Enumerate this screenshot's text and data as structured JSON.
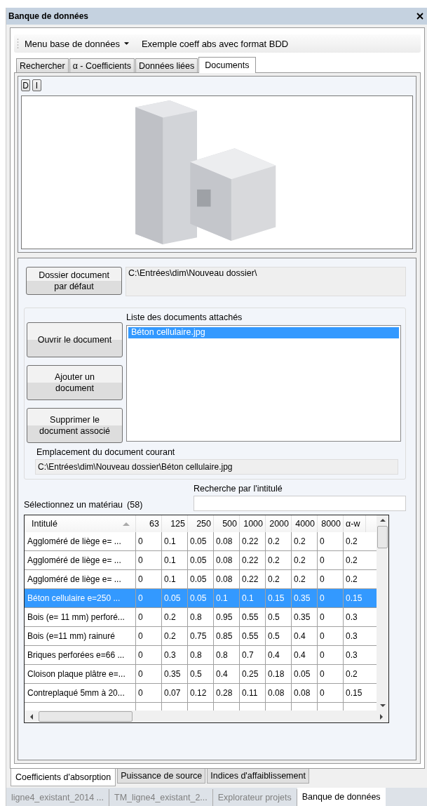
{
  "window": {
    "title": "Banque de données"
  },
  "toolbar": {
    "menu": "Menu base de données",
    "label": "Exemple coeff abs avec format BDD"
  },
  "tabs": [
    {
      "label": "Rechercher",
      "selected": false
    },
    {
      "label": "α - Coefficients",
      "selected": false
    },
    {
      "label": "Données liées",
      "selected": false
    },
    {
      "label": "Documents",
      "selected": true
    }
  ],
  "image_buttons": [
    "D",
    "I"
  ],
  "default_folder": {
    "button": "Dossier document par défaut",
    "path": "C:\\Entrées\\dim\\Nouveau dossier\\"
  },
  "documents": {
    "label": "Liste des documents attachés",
    "items": [
      {
        "name": "Béton cellulaire.jpg",
        "selected": true
      }
    ],
    "buttons": [
      "Ouvrir le document",
      "Ajouter un document",
      "Supprimer le document associé"
    ],
    "location_label": "Emplacement du document courant",
    "location": "C:\\Entrées\\dim\\Nouveau dossier\\Béton cellulaire.jpg"
  },
  "search": {
    "label": "Recherche par l'intitulé",
    "select_label": "Sélectionnez un matériau",
    "count": "(58)"
  },
  "table": {
    "columns": [
      "Intitulé",
      "63",
      "125",
      "250",
      "500",
      "1000",
      "2000",
      "4000",
      "8000",
      "α-w"
    ],
    "rows": [
      {
        "selected": false,
        "cells": [
          "Aggloméré de liège e= ...",
          "0",
          "0.1",
          "0.05",
          "0.08",
          "0.22",
          "0.2",
          "0.2",
          "0",
          "0.2"
        ]
      },
      {
        "selected": false,
        "cells": [
          "Aggloméré de liège e= ...",
          "0",
          "0.1",
          "0.05",
          "0.08",
          "0.22",
          "0.2",
          "0.2",
          "0",
          "0.2"
        ]
      },
      {
        "selected": false,
        "cells": [
          "Aggloméré de liège e= ...",
          "0",
          "0.1",
          "0.05",
          "0.08",
          "0.22",
          "0.2",
          "0.2",
          "0",
          "0.2"
        ]
      },
      {
        "selected": true,
        "cells": [
          "Béton cellulaire e=250 ...",
          "0",
          "0.05",
          "0.05",
          "0.1",
          "0.1",
          "0.15",
          "0.35",
          "0",
          "0.15"
        ]
      },
      {
        "selected": false,
        "cells": [
          "Bois (e= 11 mm) perforé...",
          "0",
          "0.2",
          "0.8",
          "0.95",
          "0.55",
          "0.5",
          "0.35",
          "0",
          "0.3"
        ]
      },
      {
        "selected": false,
        "cells": [
          "Bois (e=11 mm) rainuré",
          "0",
          "0.2",
          "0.75",
          "0.85",
          "0.55",
          "0.5",
          "0.4",
          "0",
          "0.3"
        ]
      },
      {
        "selected": false,
        "cells": [
          "Briques perforées e=66 ...",
          "0",
          "0.3",
          "0.8",
          "0.8",
          "0.7",
          "0.4",
          "0.4",
          "0",
          "0.3"
        ]
      },
      {
        "selected": false,
        "cells": [
          "Cloison plaque plâtre e=...",
          "0",
          "0.35",
          "0.5",
          "0.4",
          "0.25",
          "0.18",
          "0.05",
          "0",
          "0.2"
        ]
      },
      {
        "selected": false,
        "cells": [
          "Contreplaqué 5mm à 20...",
          "0",
          "0.07",
          "0.12",
          "0.28",
          "0.11",
          "0.08",
          "0.08",
          "0",
          "0.15"
        ]
      }
    ]
  },
  "bottom_tabs": [
    {
      "label": "Coefficients d'absorption",
      "selected": true
    },
    {
      "label": "Puissance de source",
      "selected": false
    },
    {
      "label": "Indices d'affaiblissement",
      "selected": false
    }
  ],
  "document_tabs": [
    {
      "label": "ligne4_existant_2014 ...",
      "selected": false
    },
    {
      "label": "TM_ligne4_existant_2...",
      "selected": false
    },
    {
      "label": "Explorateur projets",
      "selected": false
    },
    {
      "label": "Banque de données",
      "selected": true
    }
  ]
}
